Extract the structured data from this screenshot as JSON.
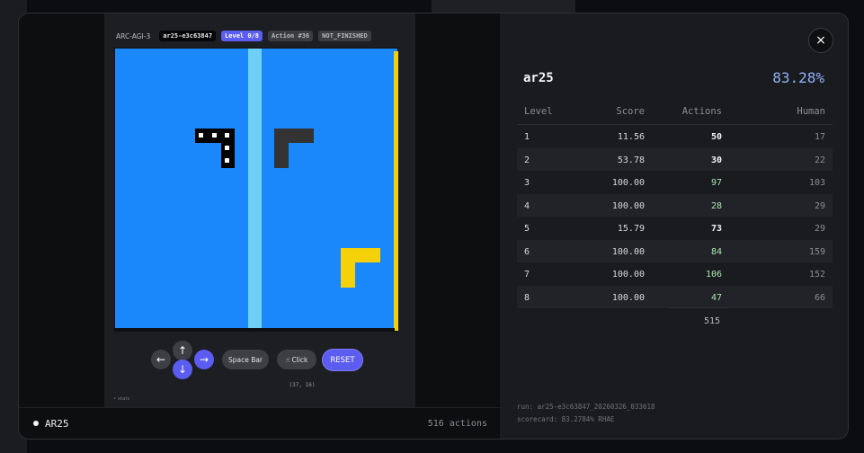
{
  "game_header": {
    "title": "ARC-AGI-3",
    "game_id": "ar25-e3c63847",
    "level": "Level 0/8",
    "action": "Action #36",
    "status": "NOT_FINISHED"
  },
  "colors": {
    "canvas_blue": "#1a88fa",
    "stripe_light_blue": "#6fd0f7",
    "yellow": "#f5d10a",
    "accent_purple": "#5b5cf0",
    "percent_blue": "#8fb0f8"
  },
  "controls": {
    "left_arrow": "←",
    "up_arrow": "↑",
    "down_arrow": "↓",
    "right_arrow": "→",
    "space_bar": "Space Bar",
    "click": "☝ Click",
    "click_coords": "(37, 16)",
    "reset": "RESET"
  },
  "stats_link": "• stats",
  "footer": {
    "game_name": "AR25",
    "actions_count": "516 actions"
  },
  "scorecard": {
    "close_icon": "×",
    "game": "ar25",
    "percent": "83.28%",
    "columns": [
      "Level",
      "Score",
      "Actions",
      "Human"
    ],
    "rows": [
      {
        "level": "1",
        "score": "11.56",
        "actions": "50",
        "human": "17",
        "actions_style": "white"
      },
      {
        "level": "2",
        "score": "53.78",
        "actions": "30",
        "human": "22",
        "actions_style": "white"
      },
      {
        "level": "3",
        "score": "100.00",
        "actions": "97",
        "human": "103",
        "actions_style": "green"
      },
      {
        "level": "4",
        "score": "100.00",
        "actions": "28",
        "human": "29",
        "actions_style": "green"
      },
      {
        "level": "5",
        "score": "15.79",
        "actions": "73",
        "human": "29",
        "actions_style": "white"
      },
      {
        "level": "6",
        "score": "100.00",
        "actions": "84",
        "human": "159",
        "actions_style": "green"
      },
      {
        "level": "7",
        "score": "100.00",
        "actions": "106",
        "human": "152",
        "actions_style": "green"
      },
      {
        "level": "8",
        "score": "100.00",
        "actions": "47",
        "human": "66",
        "actions_style": "green"
      }
    ],
    "total_actions": "515",
    "run": "run: ar25-e3c63847_20260326_033618",
    "scorecard_line": "scorecard: 83.2784% RHAE"
  }
}
